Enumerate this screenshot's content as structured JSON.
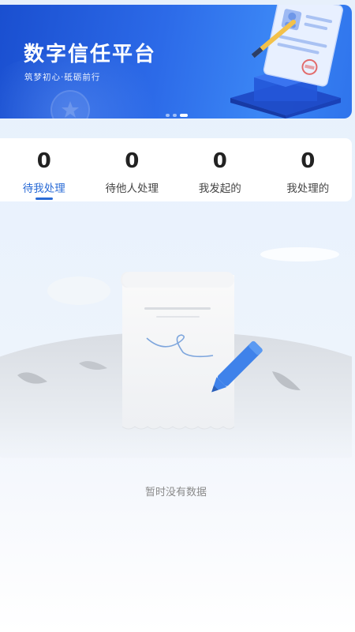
{
  "banner": {
    "title": "数字信任平台",
    "subtitle": "筑梦初心·砥砺前行",
    "slide_count": 3,
    "active_slide": 3
  },
  "stats": [
    {
      "count": "0",
      "label": "待我处理",
      "active": true
    },
    {
      "count": "0",
      "label": "待他人处理",
      "active": false
    },
    {
      "count": "0",
      "label": "我发起的",
      "active": false
    },
    {
      "count": "0",
      "label": "我处理的",
      "active": false
    }
  ],
  "empty_state": {
    "message": "暂时没有数据",
    "illustration": "document-with-pen-icon"
  },
  "colors": {
    "accent": "#2a6bd6",
    "banner_start": "#1a4fd0",
    "banner_end": "#3b86f5",
    "text_primary": "#222222",
    "text_muted": "#8a8a8a"
  }
}
